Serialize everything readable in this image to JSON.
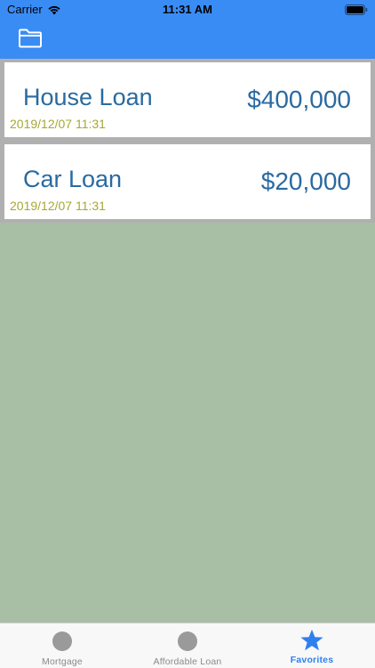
{
  "status_bar": {
    "carrier": "Carrier",
    "time": "11:31 AM"
  },
  "nav": {
    "icon": "folder-icon"
  },
  "loans": [
    {
      "title": "House Loan",
      "amount": "$400,000",
      "date": "2019/12/07 11:31"
    },
    {
      "title": "Car Loan",
      "amount": "$20,000",
      "date": "2019/12/07 11:31"
    }
  ],
  "tabs": [
    {
      "label": "Mortgage",
      "icon": "circle-icon"
    },
    {
      "label": "Affordable Loan",
      "icon": "circle-icon"
    },
    {
      "label": "Favorites",
      "icon": "star-icon",
      "active": true
    }
  ],
  "colors": {
    "accent": "#3a8cf5",
    "title_text": "#2a6aa0",
    "date_text": "#a7a832",
    "background": "#a8bfa6",
    "active_tab": "#2f80ed"
  }
}
